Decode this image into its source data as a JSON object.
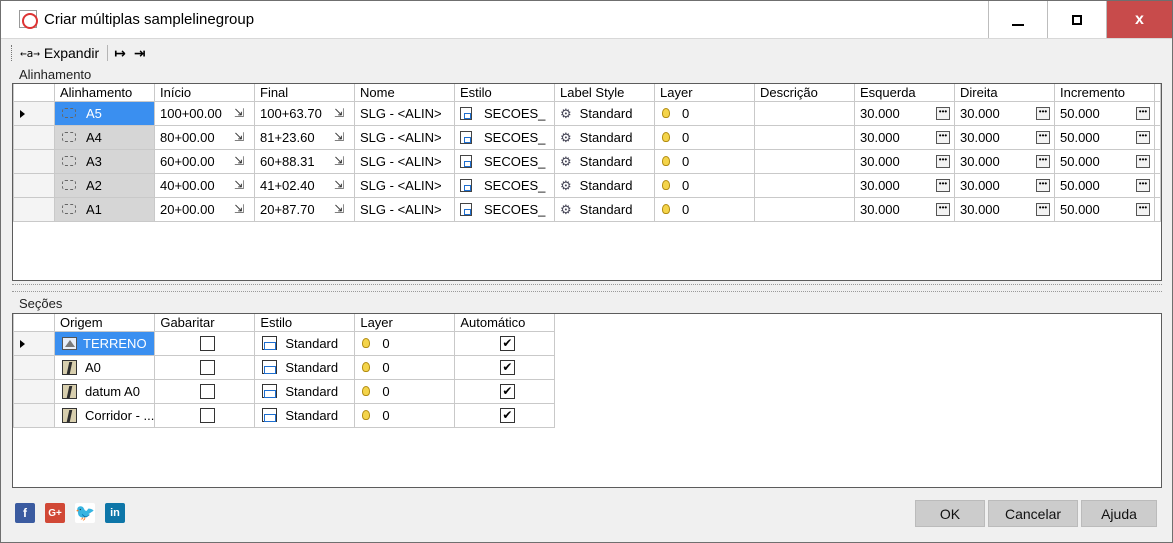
{
  "window": {
    "title": "Criar múltiplas samplelinegroup",
    "minimize": "–",
    "maximize": "□",
    "close": "x"
  },
  "toolbar": {
    "expand_label": "Expandir",
    "expand_icon": "↔",
    "collapse_all_icon": "↦",
    "expand_all_icon": "⇥"
  },
  "alinhamento": {
    "group_label": "Alinhamento",
    "columns": [
      "Alinhamento",
      "Início",
      "Final",
      "Nome",
      "Estilo",
      "Label Style",
      "Layer",
      "Descrição",
      "Esquerda",
      "Direita",
      "Incremento"
    ],
    "rows": [
      {
        "alinhamento": "A5",
        "inicio": "100+00.00",
        "final": "100+63.70",
        "nome": "SLG - <ALIN>",
        "estilo": "SECOES_",
        "label_style": "Standard",
        "layer": "0",
        "descricao": "",
        "esquerda": "30.000",
        "direita": "30.000",
        "incremento": "50.000"
      },
      {
        "alinhamento": "A4",
        "inicio": "80+00.00",
        "final": "81+23.60",
        "nome": "SLG - <ALIN>",
        "estilo": "SECOES_",
        "label_style": "Standard",
        "layer": "0",
        "descricao": "",
        "esquerda": "30.000",
        "direita": "30.000",
        "incremento": "50.000"
      },
      {
        "alinhamento": "A3",
        "inicio": "60+00.00",
        "final": "60+88.31",
        "nome": "SLG - <ALIN>",
        "estilo": "SECOES_",
        "label_style": "Standard",
        "layer": "0",
        "descricao": "",
        "esquerda": "30.000",
        "direita": "30.000",
        "incremento": "50.000"
      },
      {
        "alinhamento": "A2",
        "inicio": "40+00.00",
        "final": "41+02.40",
        "nome": "SLG - <ALIN>",
        "estilo": "SECOES_",
        "label_style": "Standard",
        "layer": "0",
        "descricao": "",
        "esquerda": "30.000",
        "direita": "30.000",
        "incremento": "50.000"
      },
      {
        "alinhamento": "A1",
        "inicio": "20+00.00",
        "final": "20+87.70",
        "nome": "SLG - <ALIN>",
        "estilo": "SECOES_",
        "label_style": "Standard",
        "layer": "0",
        "descricao": "",
        "esquerda": "30.000",
        "direita": "30.000",
        "incremento": "50.000"
      }
    ]
  },
  "secoes": {
    "group_label": "Seções",
    "columns": [
      "Origem",
      "Gabaritar",
      "Estilo",
      "Layer",
      "Automático"
    ],
    "rows": [
      {
        "origem": "TERRENO",
        "gabaritar": false,
        "estilo": "Standard",
        "layer": "0",
        "automatico": true
      },
      {
        "origem": "A0",
        "gabaritar": false,
        "estilo": "Standard",
        "layer": "0",
        "automatico": true
      },
      {
        "origem": "datum A0",
        "gabaritar": false,
        "estilo": "Standard",
        "layer": "0",
        "automatico": true
      },
      {
        "origem": "Corridor - ...",
        "gabaritar": false,
        "estilo": "Standard",
        "layer": "0",
        "automatico": true
      }
    ]
  },
  "footer": {
    "social": [
      "f",
      "G+",
      "twitter-bird",
      "in"
    ],
    "ok_label": "OK",
    "cancel_label": "Cancelar",
    "help_label": "Ajuda"
  },
  "colors": {
    "selection": "#3a8ff0",
    "close_button": "#c84b4b"
  }
}
